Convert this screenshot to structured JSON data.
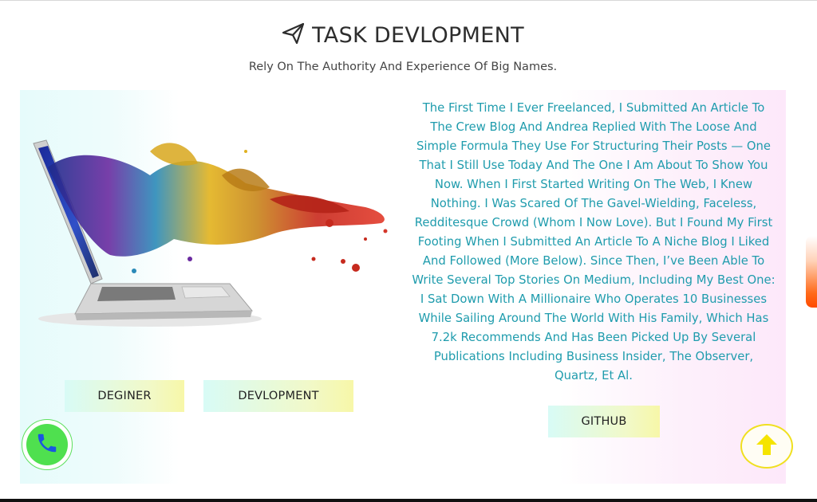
{
  "header": {
    "title": "TASK DEVLOPMENT",
    "subtitle": "Rely On The Authority And Experience Of Big Names.",
    "title_icon": "paper-plane-icon"
  },
  "left": {
    "illustration": "laptop-paint-splash-image",
    "buttons": {
      "designer_label": "DEGINER",
      "development_label": "DEVLOPMENT"
    }
  },
  "right": {
    "article_text": "The First Time I Ever Freelanced, I Submitted An Article To The Crew Blog And Andrea Replied With The Loose And Simple Formula They Use For Structuring Their Posts — One That I Still Use Today And The One I Am About To Show You Now. When I First Started Writing On The Web, I Knew Nothing. I Was Scared Of The Gavel-Wielding, Faceless, Redditesque Crowd (Whom I Now Love). But I Found My First Footing When I Submitted An Article To A Niche Blog I Liked And Followed (More Below). Since Then, I’ve Been Able To Write Several Top Stories On Medium, Including My Best One: I Sat Down With A Millionaire Who Operates 10 Businesses While Sailing Around The World With His Family, Which Has 7.2k Recommends And Has Been Picked Up By Several Publications Including Business Insider, The Observer, Quartz, Et Al.",
    "github_label": "GITHUB"
  },
  "floating": {
    "phone_icon": "phone-icon",
    "up_icon": "arrow-up-icon"
  },
  "colors": {
    "article_text": "#1f9cad",
    "phone_green": "#4fe04f",
    "up_yellow": "#f5e400",
    "scroll_orange": "#ff5a0a"
  }
}
